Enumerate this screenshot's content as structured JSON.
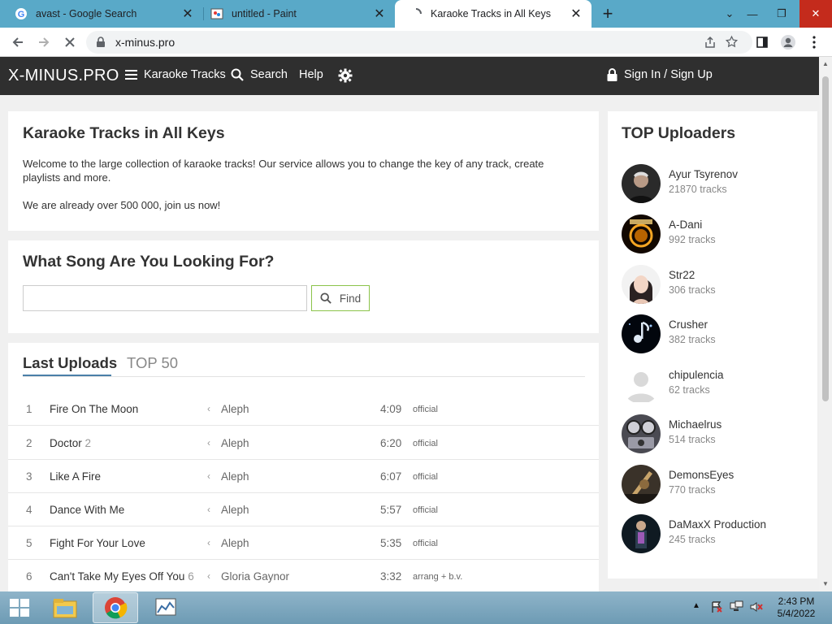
{
  "browser": {
    "tabs": [
      {
        "title": "avast - Google Search",
        "icon": "google-g-icon"
      },
      {
        "title": "untitled - Paint",
        "icon": "paint-icon"
      },
      {
        "title": "Karaoke Tracks in All Keys",
        "icon": "loading-spinner-icon",
        "active": true
      }
    ],
    "new_tab_label": "+",
    "url": "x-minus.pro"
  },
  "site": {
    "logo": "X-MINUS.PRO",
    "nav": {
      "karaoke": "Karaoke Tracks",
      "search": "Search",
      "help": "Help",
      "signin": "Sign In / Sign Up"
    },
    "intro": {
      "title": "Karaoke Tracks in All Keys",
      "text1": "Welcome to the large collection of karaoke tracks! Our service allows you to change the key of any track, create playlists and more.",
      "text2": "We are already over 500 000, join us now!"
    },
    "search": {
      "title": "What Song Are You Looking For?",
      "placeholder": "",
      "button": "Find"
    },
    "uploads_tabs": {
      "last": "Last Uploads",
      "top50": "TOP 50"
    },
    "uploads": [
      {
        "n": "1",
        "song": "Fire On The Moon",
        "ver": "",
        "artist": "Aleph",
        "dur": "4:09",
        "type": "official"
      },
      {
        "n": "2",
        "song": "Doctor",
        "ver": "2",
        "artist": "Aleph",
        "dur": "6:20",
        "type": "official"
      },
      {
        "n": "3",
        "song": "Like A Fire",
        "ver": "",
        "artist": "Aleph",
        "dur": "6:07",
        "type": "official"
      },
      {
        "n": "4",
        "song": "Dance With Me",
        "ver": "",
        "artist": "Aleph",
        "dur": "5:57",
        "type": "official"
      },
      {
        "n": "5",
        "song": "Fight For Your Love",
        "ver": "",
        "artist": "Aleph",
        "dur": "5:35",
        "type": "official"
      },
      {
        "n": "6",
        "song": "Can't Take My Eyes Off You",
        "ver": "6",
        "artist": "Gloria Gaynor",
        "dur": "3:32",
        "type": "arrang + b.v."
      }
    ],
    "top_uploaders": {
      "title": "TOP Uploaders",
      "items": [
        {
          "name": "Ayur Tsyrenov",
          "tracks": "21870 tracks"
        },
        {
          "name": "A-Dani",
          "tracks": "992 tracks"
        },
        {
          "name": "Str22",
          "tracks": "306 tracks"
        },
        {
          "name": "Crusher",
          "tracks": "382 tracks"
        },
        {
          "name": "chipulencia",
          "tracks": "62 tracks"
        },
        {
          "name": "Michaelrus",
          "tracks": "514 tracks"
        },
        {
          "name": "DemonsEyes",
          "tracks": "770 tracks"
        },
        {
          "name": "DaMaxX Production",
          "tracks": "245 tracks"
        }
      ]
    }
  },
  "taskbar": {
    "time": "2:43 PM",
    "date": "5/4/2022"
  },
  "colors": {
    "accent_green": "#8bc34a",
    "tab_underline": "#4a7fa8",
    "header_bg": "#2f2f2f",
    "chrome_tabbar": "#59a9c8"
  }
}
